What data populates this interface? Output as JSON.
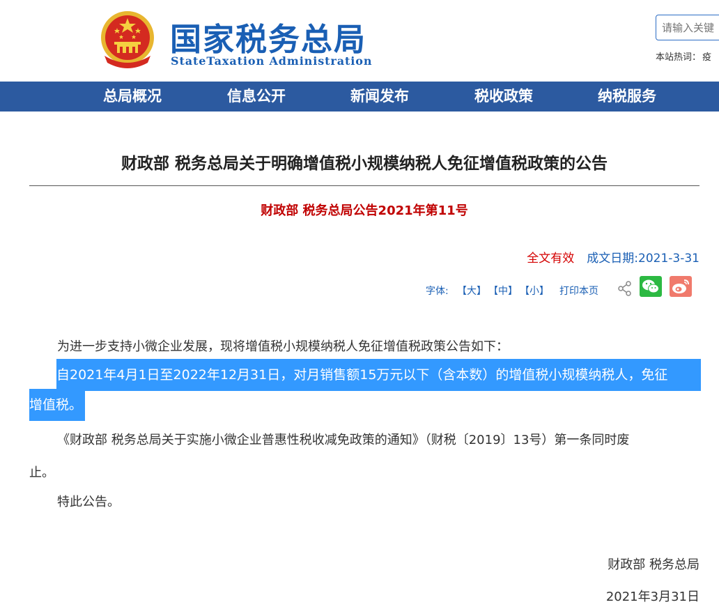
{
  "header": {
    "logo_cn": "国家税务总局",
    "logo_en": "StateTaxation Administration",
    "search_placeholder": "请输入关键",
    "hot_label": "本站热词：",
    "hot_word": "疫"
  },
  "nav": {
    "items": [
      {
        "label": "总局概况"
      },
      {
        "label": "信息公开"
      },
      {
        "label": "新闻发布"
      },
      {
        "label": "税收政策"
      },
      {
        "label": "纳税服务"
      }
    ]
  },
  "article": {
    "title": "财政部 税务总局关于明确增值税小规模纳税人免征增值税政策的公告",
    "doc_no": "财政部 税务总局公告2021年第11号",
    "validity": "全文有效",
    "date": "成文日期:2021-3-31",
    "tools": {
      "font_label": "字体:",
      "large": "【大】",
      "medium": "【中】",
      "small": "【小】",
      "print": "打印本页"
    },
    "para1": "为进一步支持小微企业发展，现将增值税小规模纳税人免征增值税政策公告如下：",
    "para2_line1": "自2021年4月1日至2022年12月31日，对月销售额15万元以下（含本数）的增值税小规模纳税人，免征",
    "para2_line2": "增值税。",
    "para3_line1": "《财政部 税务总局关于实施小微企业普惠性税收减免政策的通知》（财税〔2019〕13号）第一条同时废",
    "para3_line2": "止。",
    "para4": "特此公告。",
    "signature": "财政部  税务总局",
    "sign_date": "2021年3月31日"
  },
  "colors": {
    "nav_bg": "#2c5aa0",
    "brand_blue": "#1a5fb4",
    "highlight": "#3399ff",
    "red": "#c00000"
  }
}
